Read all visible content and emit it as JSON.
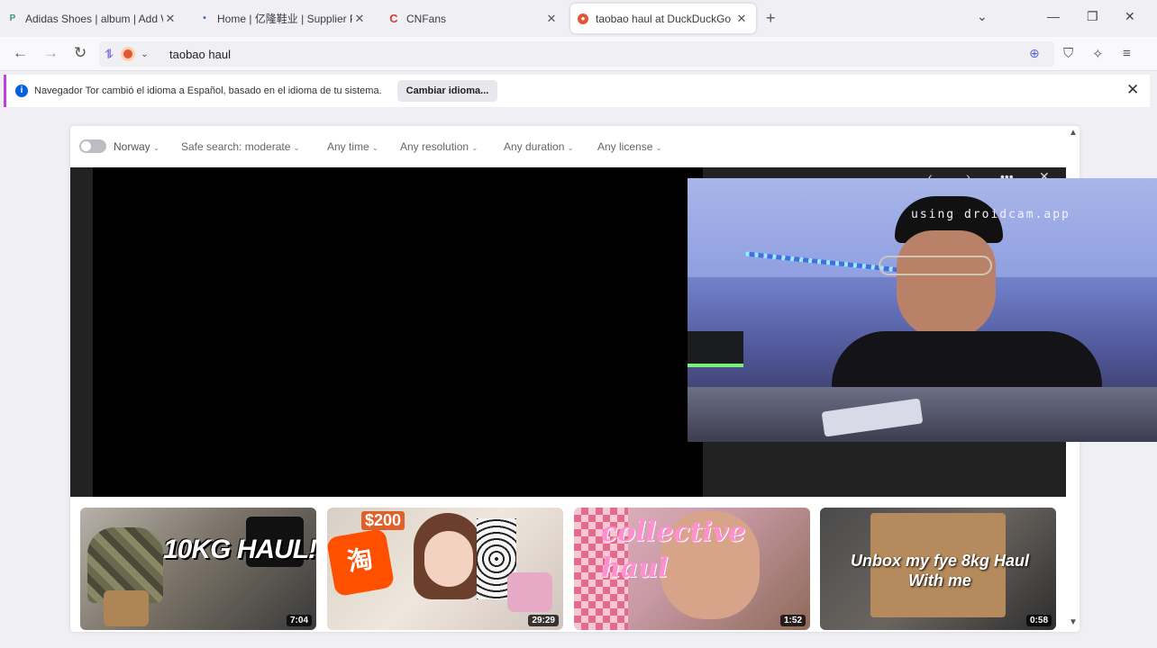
{
  "tabs": [
    {
      "title": "Adidas Shoes | album | Add Wh",
      "favicon": "p-icon",
      "active": false
    },
    {
      "title": "Home | 亿隆鞋业 | Supplier Prod",
      "favicon": "dot-icon",
      "active": false
    },
    {
      "title": "CNFans",
      "favicon": "cnfans-icon",
      "active": false
    },
    {
      "title": "taobao haul at DuckDuckGo",
      "favicon": "duckduckgo-icon",
      "active": true
    }
  ],
  "address_bar": {
    "value": "taobao haul"
  },
  "notification": {
    "text": "Navegador Tor cambió el idioma a Español, basado en el idioma de tu sistema.",
    "button_label": "Cambiar idioma..."
  },
  "filters": {
    "region": "Norway",
    "safe_search": "Safe search: moderate",
    "time": "Any time",
    "resolution": "Any resolution",
    "duration": "Any duration",
    "license": "Any license"
  },
  "thumbnails": [
    {
      "overlay_text": "10KG HAUL!",
      "duration": "7:04"
    },
    {
      "overlay_text": "$200",
      "duration": "29:29"
    },
    {
      "overlay_text": "collective haul",
      "duration": "1:52"
    },
    {
      "overlay_text": "Unbox my fye 8kg Haul With me",
      "duration": "0:58"
    }
  ],
  "webcam": {
    "label": "using droidcam.app"
  },
  "colors": {
    "accent": "#c13ee5",
    "info": "#0060df",
    "ddg": "#de5833"
  }
}
